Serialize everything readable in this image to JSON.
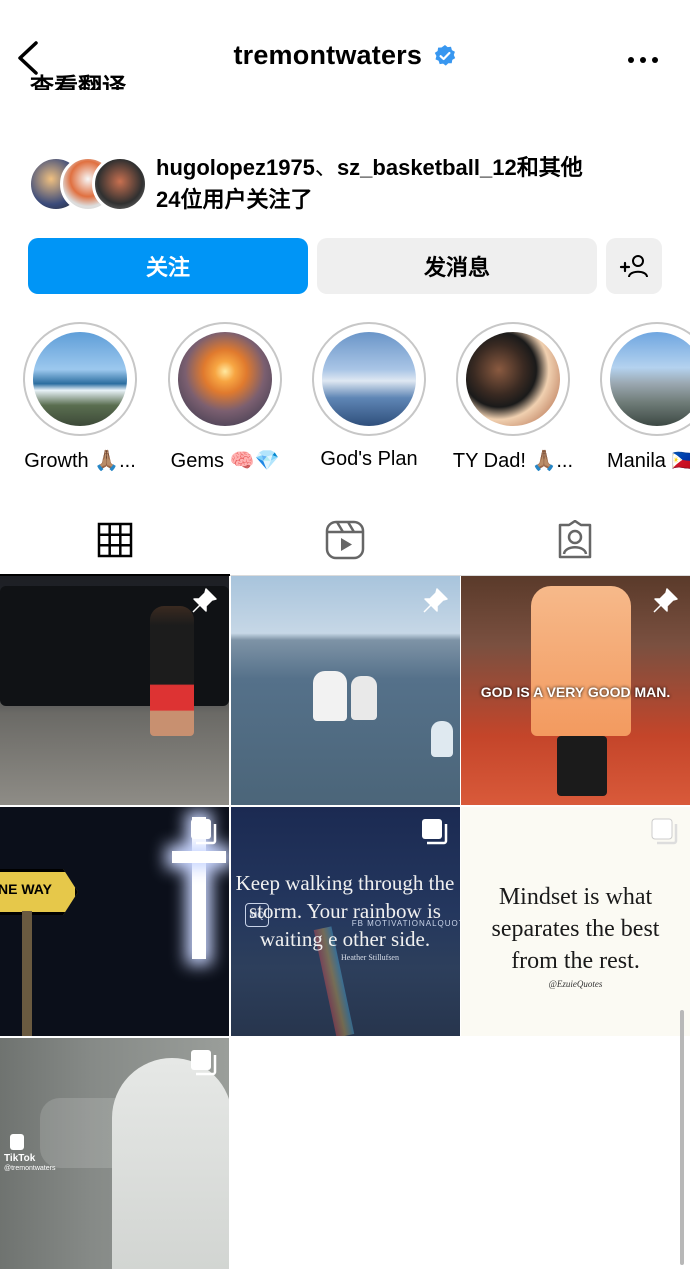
{
  "header": {
    "username": "tremontwaters",
    "icons": {
      "back": "chevron-left-icon",
      "verified": "verified-badge-icon",
      "more": "more-horizontal-icon"
    },
    "verified_color": "#3897f0"
  },
  "cut_text": "查看翻译",
  "mutual": {
    "user1": "hugolopez1975",
    "sep": "、",
    "user2": "sz_basketball_12",
    "and_others": "和其他",
    "count": "24",
    "tail": "位用户关注了"
  },
  "actions": {
    "follow_label": "关注",
    "message_label": "发消息",
    "add_icon": "add-person-icon",
    "accent": "#0095f6"
  },
  "highlights": [
    {
      "label": "Growth 🙏🏽..."
    },
    {
      "label": "Gems 🧠💎"
    },
    {
      "label": "God's Plan"
    },
    {
      "label": "TY Dad! 🙏🏽..."
    },
    {
      "label": "Manila 🇵🇭"
    }
  ],
  "tabs": [
    {
      "name": "grid",
      "icon": "grid-icon",
      "active": true
    },
    {
      "name": "reels",
      "icon": "reels-icon",
      "active": false
    },
    {
      "name": "tagged",
      "icon": "tagged-person-icon",
      "active": false
    }
  ],
  "posts": [
    {
      "badge": "pin",
      "caption": ""
    },
    {
      "badge": "pin",
      "caption": ""
    },
    {
      "badge": "pin",
      "caption": "GOD IS A VERY GOOD MAN."
    },
    {
      "badge": "carousel",
      "caption": "NE WAY"
    },
    {
      "badge": "carousel",
      "caption": "Keep walking through the storm. Your rainbow is waiting e other side.",
      "credit": "Heather Stillufsen",
      "watermark": "FB MOTIVATIONALQUOTE",
      "logo": "MQ"
    },
    {
      "badge": "carousel",
      "caption": "Mindset is what separates the best from the rest.",
      "credit": "@EzuieQuotes"
    },
    {
      "badge": "carousel",
      "caption": "TikTok",
      "handle": "@tremontwaters"
    }
  ]
}
